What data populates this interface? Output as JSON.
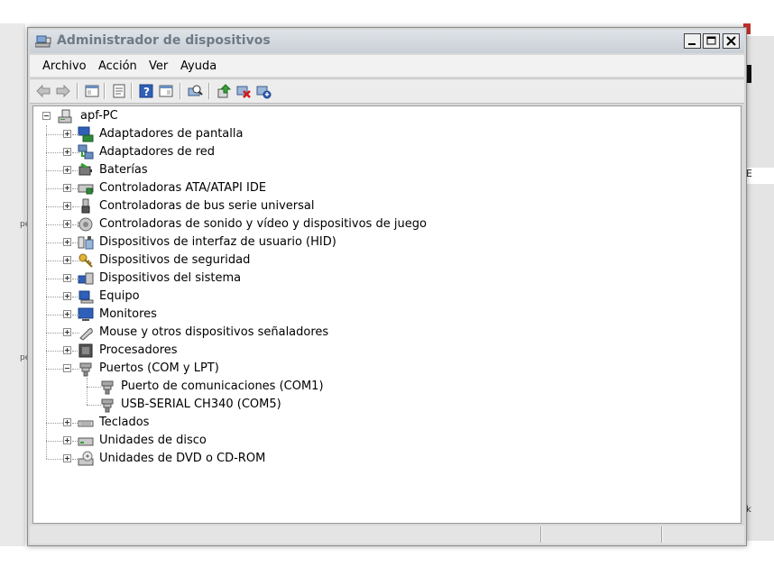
{
  "window": {
    "title": "Administrador de dispositivos"
  },
  "menu": [
    "Archivo",
    "Acción",
    "Ver",
    "Ayuda"
  ],
  "toolbar_icons": [
    "back-icon",
    "forward-icon",
    "show-hide-tree-icon",
    "properties-icon",
    "help-icon",
    "action-pane-icon",
    "scan-hardware-icon",
    "update-driver-icon",
    "uninstall-icon",
    "disable-icon"
  ],
  "tree": {
    "root": "apf-PC",
    "categories": [
      {
        "label": "Adaptadores de pantalla",
        "icon": "display-adapter-icon"
      },
      {
        "label": "Adaptadores de red",
        "icon": "network-adapter-icon"
      },
      {
        "label": "Baterías",
        "icon": "battery-icon"
      },
      {
        "label": "Controladoras ATA/ATAPI IDE",
        "icon": "ide-controller-icon"
      },
      {
        "label": "Controladoras de bus serie universal",
        "icon": "usb-icon"
      },
      {
        "label": "Controladoras de sonido y vídeo y dispositivos de juego",
        "icon": "sound-icon"
      },
      {
        "label": "Dispositivos de interfaz de usuario (HID)",
        "icon": "hid-icon"
      },
      {
        "label": "Dispositivos de seguridad",
        "icon": "security-key-icon"
      },
      {
        "label": "Dispositivos del sistema",
        "icon": "system-device-icon"
      },
      {
        "label": "Equipo",
        "icon": "computer-icon"
      },
      {
        "label": "Monitores",
        "icon": "monitor-icon"
      },
      {
        "label": "Mouse y otros dispositivos señaladores",
        "icon": "mouse-icon"
      },
      {
        "label": "Procesadores",
        "icon": "processor-icon"
      },
      {
        "label": "Puertos (COM y LPT)",
        "icon": "port-icon",
        "expanded": true,
        "children": [
          {
            "label": "Puerto de comunicaciones (COM1)",
            "icon": "port-icon"
          },
          {
            "label": "USB-SERIAL CH340 (COM5)",
            "icon": "port-icon"
          }
        ]
      },
      {
        "label": "Teclados",
        "icon": "keyboard-icon"
      },
      {
        "label": "Unidades de disco",
        "icon": "disk-drive-icon"
      },
      {
        "label": "Unidades de DVD o CD-ROM",
        "icon": "dvd-drive-icon"
      }
    ]
  },
  "colors": {
    "title_text": "#6d7a86",
    "selection": "#3399ff"
  }
}
